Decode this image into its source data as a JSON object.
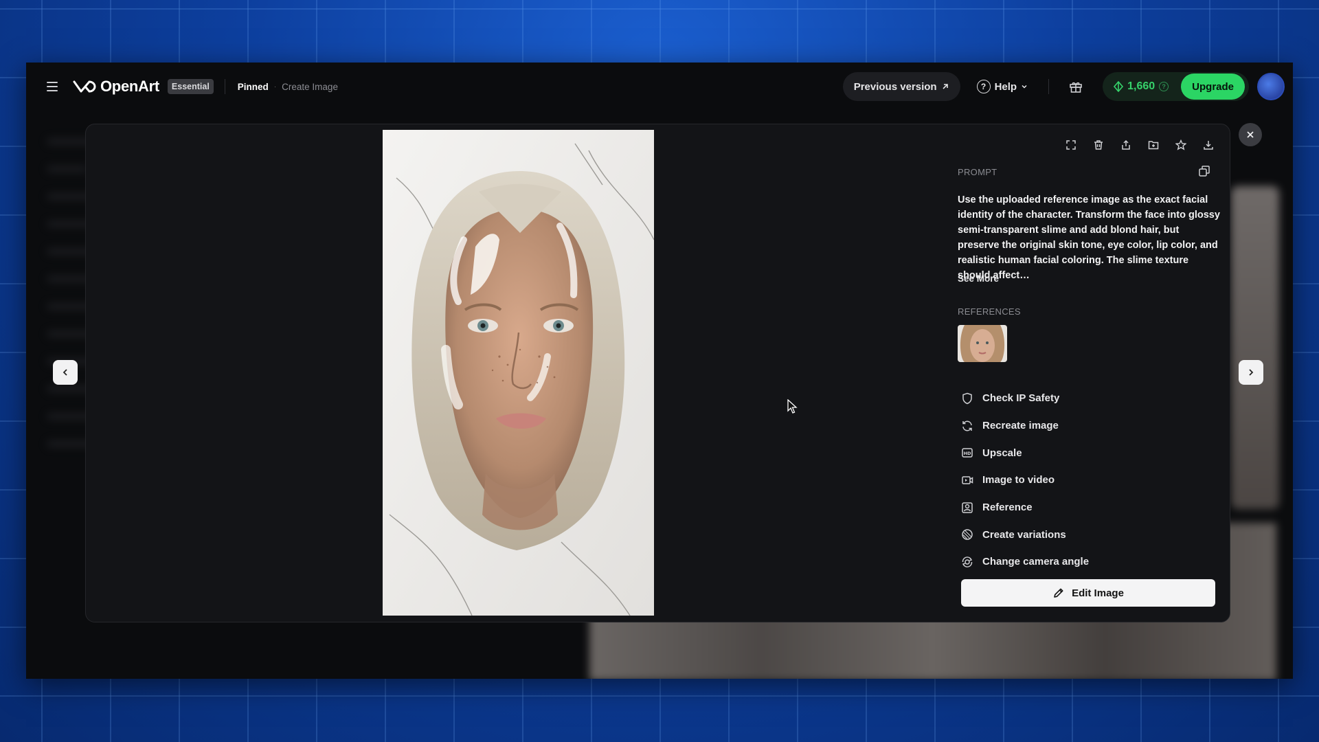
{
  "header": {
    "logo_text": "OpenArt",
    "plan_badge": "Essential",
    "breadcrumb_active": "Pinned",
    "breadcrumb_separator": "·",
    "breadcrumb_current": "Create Image",
    "previous_version_label": "Previous version",
    "previous_version_icon": "arrow-up-right-icon",
    "help_label": "Help",
    "credits_value": "1,660",
    "upgrade_label": "Upgrade"
  },
  "modal": {
    "toolbar_icons": [
      "fullscreen-icon",
      "trash-icon",
      "share-icon",
      "add-to-folder-icon",
      "star-icon",
      "download-icon"
    ],
    "prompt_label": "PROMPT",
    "prompt_text": "Use the uploaded reference image as the exact facial identity of the character. Transform the face into glossy semi-transparent slime and add blond hair, but preserve the original skin tone, eye color, lip color, and realistic human facial coloring. The slime texture should affect…",
    "see_more_label": "See More",
    "references_label": "REFERENCES",
    "actions": [
      {
        "label": "Check IP Safety",
        "icon": "shield-icon"
      },
      {
        "label": "Recreate image",
        "icon": "refresh-icon"
      },
      {
        "label": "Upscale",
        "icon": "hd-icon"
      },
      {
        "label": "Image to video",
        "icon": "video-icon"
      },
      {
        "label": "Reference",
        "icon": "image-reference-icon"
      },
      {
        "label": "Create variations",
        "icon": "variations-icon"
      },
      {
        "label": "Change camera angle",
        "icon": "camera-angle-icon"
      }
    ],
    "edit_button_label": "Edit Image"
  },
  "colors": {
    "accent_green": "#2bd564",
    "credits_green": "#36d26b",
    "modal_bg": "#131417",
    "app_bg": "#0b0c0e"
  }
}
